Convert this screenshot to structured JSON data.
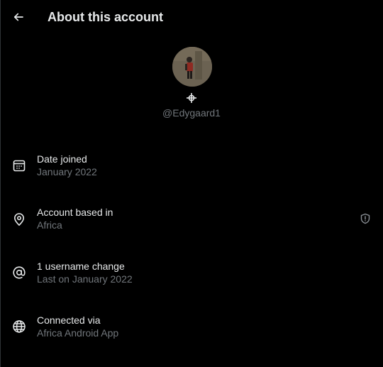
{
  "header": {
    "back_icon": "arrow-left-icon",
    "title": "About this account"
  },
  "profile": {
    "avatar_icon": "avatar",
    "verify_icon": "crosshair-icon",
    "handle": "@Edygaard1"
  },
  "details": [
    {
      "icon": "calendar-icon",
      "label": "Date joined",
      "value": "January 2022"
    },
    {
      "icon": "location-pin-icon",
      "label": "Account based in",
      "value": "Africa",
      "extra_icon": "shield-icon"
    },
    {
      "icon": "at-sign-icon",
      "label": "1 username change",
      "value": "Last on January 2022"
    },
    {
      "icon": "globe-icon",
      "label": "Connected via",
      "value": "Africa Android App"
    }
  ],
  "colors": {
    "background": "#000000",
    "primary_text": "#e7e9ea",
    "secondary_text": "#71767b"
  }
}
